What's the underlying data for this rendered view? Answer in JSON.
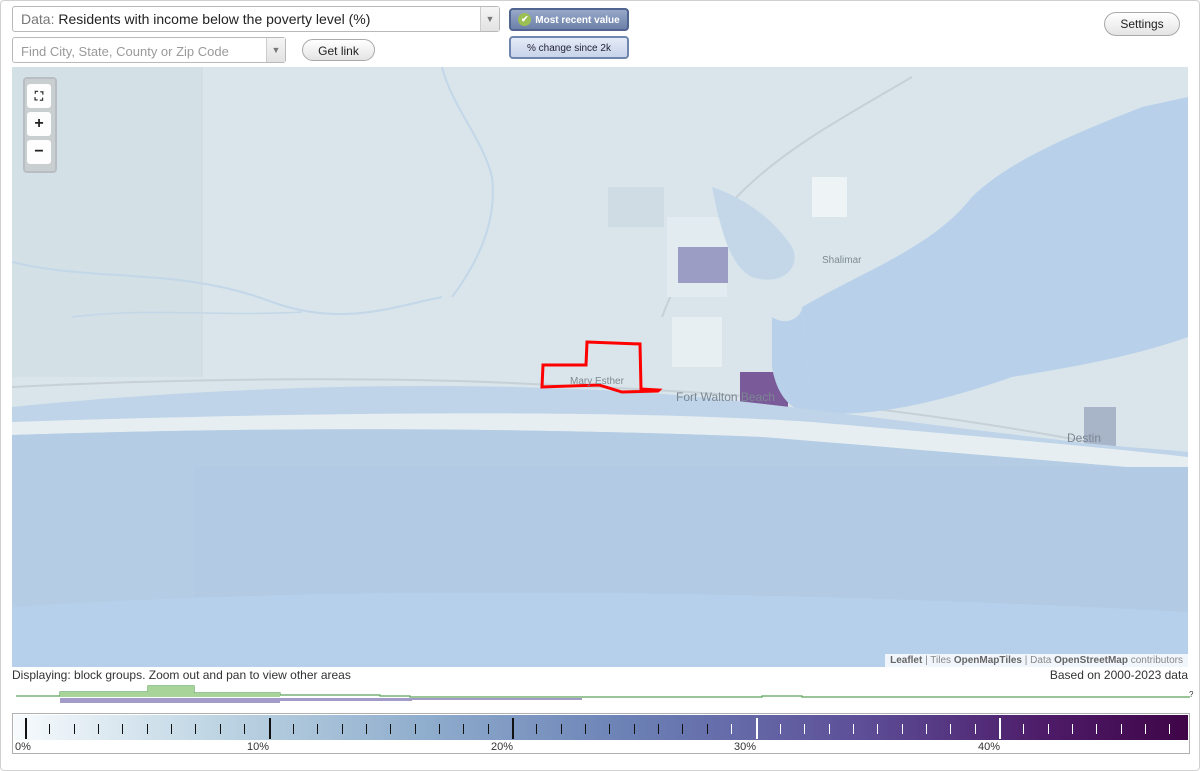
{
  "data_select": {
    "prefix": "Data:",
    "value": "Residents with income below the poverty level (%)"
  },
  "search": {
    "placeholder": "Find City, State, County or Zip Code"
  },
  "buttons": {
    "get_link": "Get link",
    "settings": "Settings"
  },
  "toggles": {
    "most_recent": "Most recent value",
    "change_since": "% change since 2k"
  },
  "map": {
    "zoom_in": "+",
    "zoom_out": "−",
    "labels": {
      "shalimar": "Shalimar",
      "mary_esther": "Mary Esther",
      "fort_walton": "Fort Walton Beach",
      "destin": "Destin"
    },
    "attribution": {
      "leaflet": "Leaflet",
      "tiles_prefix": " | Tiles ",
      "tiles": "OpenMapTiles",
      "data_prefix": " | Data ",
      "data": "OpenStreetMap",
      "suffix": " contributors"
    },
    "colors": {
      "water": "#b8d0ea",
      "land": "#d8e4ea",
      "highlight": "#ff0000"
    }
  },
  "status": "Displaying: block groups. Zoom out and pan to view other areas",
  "based_on": "Based on 2000-2023 data",
  "histogram": {
    "question": "?"
  },
  "legend": {
    "labels": [
      "0%",
      "10%",
      "20%",
      "30%",
      "40%"
    ]
  }
}
